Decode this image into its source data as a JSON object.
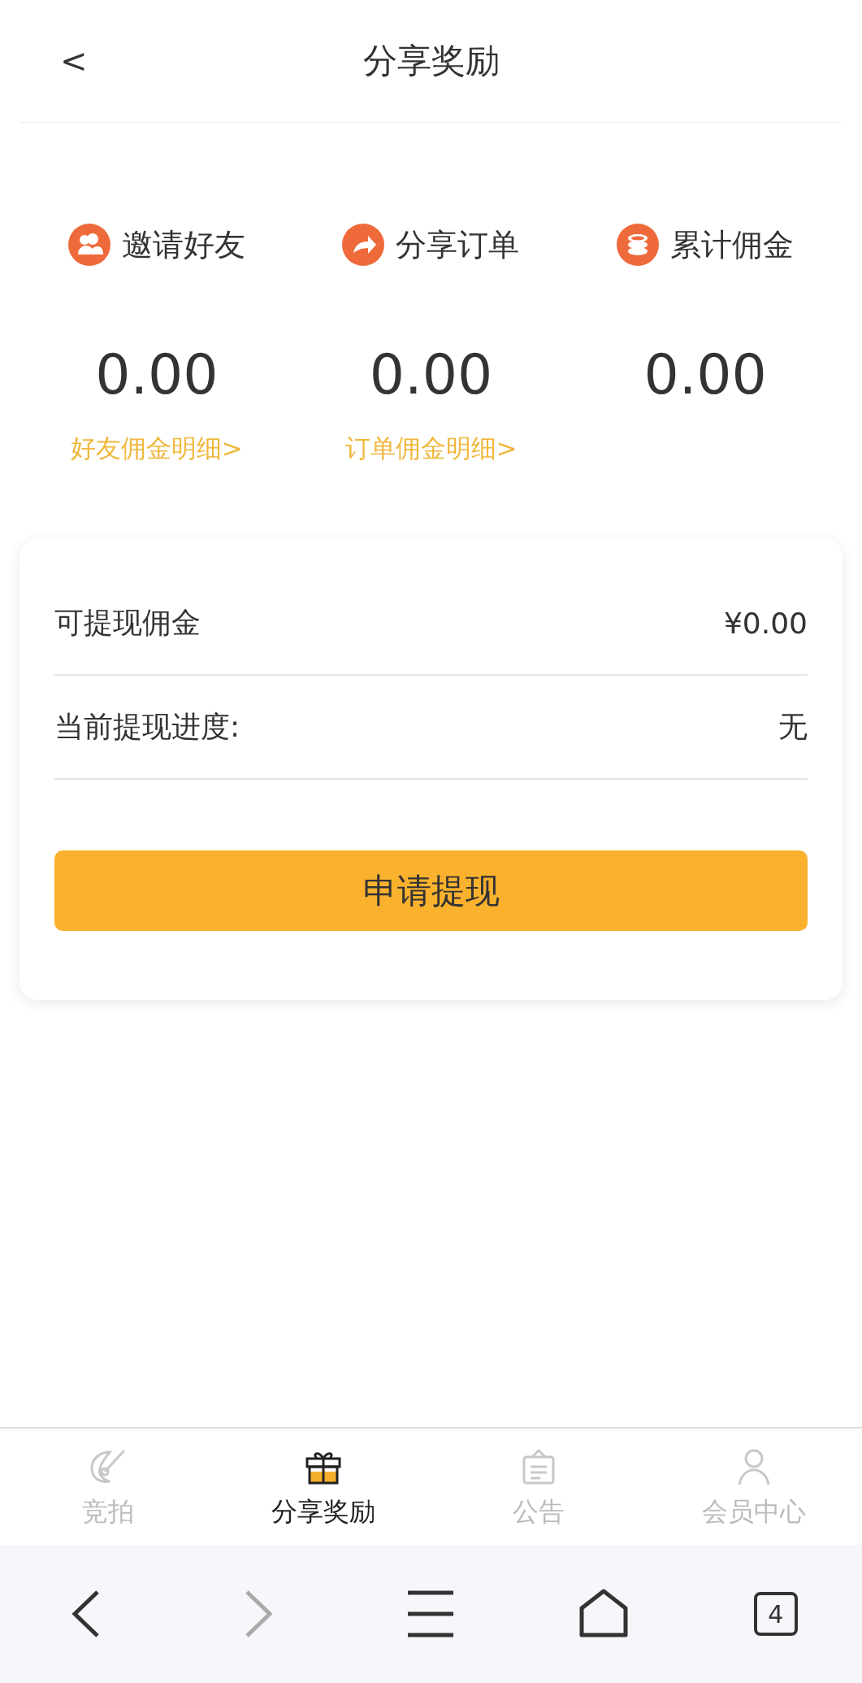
{
  "header": {
    "back": "<",
    "title": "分享奖励"
  },
  "stats": [
    {
      "kind": "friends",
      "label": "邀请好友",
      "value": "0.00",
      "link": "好友佣金明细>"
    },
    {
      "kind": "share",
      "label": "分享订单",
      "value": "0.00",
      "link": "订单佣金明细>"
    },
    {
      "kind": "coins",
      "label": "累计佣金",
      "value": "0.00"
    }
  ],
  "card": {
    "rows": [
      {
        "label": "可提现佣金",
        "value": "¥0.00"
      },
      {
        "label": "当前提现进度:",
        "value": "无"
      }
    ],
    "button": "申请提现"
  },
  "tab_bar": [
    {
      "kind": "auction",
      "label": "竞拍",
      "selected": false
    },
    {
      "kind": "gift",
      "label": "分享奖励",
      "selected": true
    },
    {
      "kind": "notice",
      "label": "公告",
      "selected": false
    },
    {
      "kind": "member",
      "label": "会员中心",
      "selected": false
    }
  ],
  "browser_bar": {
    "back_disabled": false,
    "forward_disabled": true,
    "tab_count": "4"
  }
}
